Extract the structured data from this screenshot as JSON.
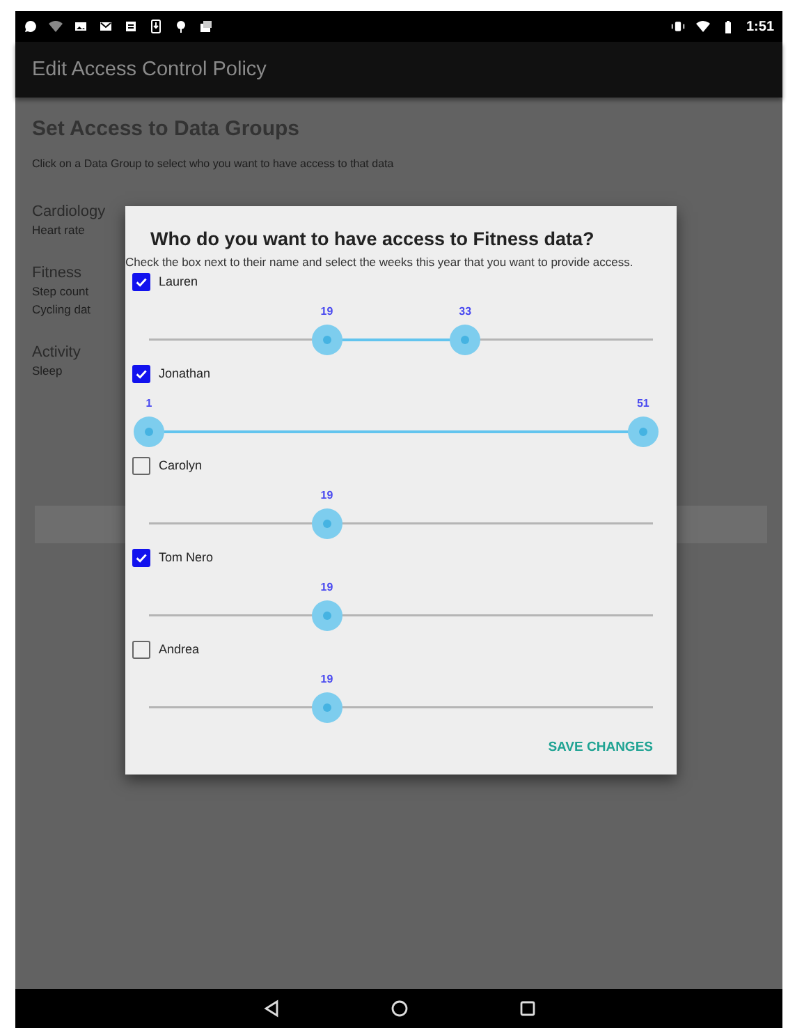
{
  "status_bar": {
    "time": "1:51"
  },
  "app_bar": {
    "title": "Edit Access Control Policy"
  },
  "page": {
    "title": "Set Access to Data Groups",
    "subtitle": "Click on a Data Group to select who you want to have access to that data",
    "groups": [
      {
        "name": "Cardiology",
        "items": [
          "Heart rate"
        ]
      },
      {
        "name": "Fitness",
        "items": [
          "Step count",
          "Cycling dat"
        ]
      },
      {
        "name": "Activity",
        "items": [
          "Sleep"
        ]
      }
    ]
  },
  "dialog": {
    "title": "Who do you want to have access to Fitness data?",
    "description": "Check the box next to their name and select the weeks this year that you want to provide access.",
    "people": [
      {
        "name": "Lauren",
        "checked": true,
        "thumbs": [
          "19",
          "33"
        ]
      },
      {
        "name": "Jonathan",
        "checked": true,
        "thumbs": [
          "1",
          "51"
        ]
      },
      {
        "name": "Carolyn",
        "checked": false,
        "thumbs": [
          "19"
        ]
      },
      {
        "name": "Tom Nero",
        "checked": true,
        "thumbs": [
          "19"
        ]
      },
      {
        "name": "Andrea",
        "checked": false,
        "thumbs": [
          "19"
        ]
      }
    ],
    "button": "SAVE CHANGES"
  }
}
